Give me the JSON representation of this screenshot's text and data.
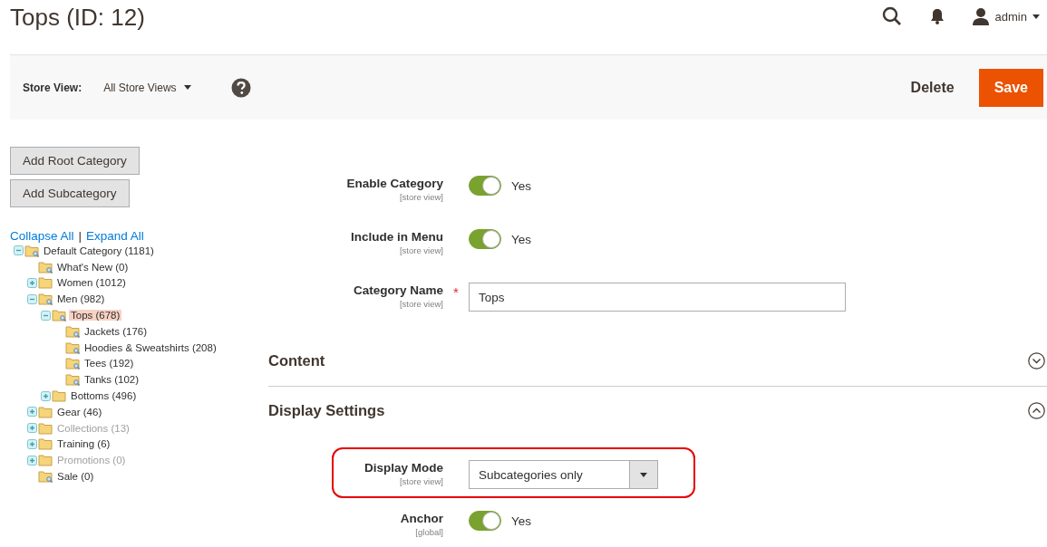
{
  "page_title": "Tops (ID: 12)",
  "header": {
    "user": "admin"
  },
  "toolbar": {
    "store_view_label": "Store View:",
    "store_view_value": "All Store Views",
    "actions": [
      {
        "label": "Delete",
        "kind": "secondary"
      },
      {
        "label": "Save",
        "kind": "primary"
      }
    ]
  },
  "sidebar": {
    "buttons": [
      "Add Root Category",
      "Add Subcategory"
    ],
    "collapse_all": "Collapse All",
    "separator": "|",
    "expand_all": "Expand All",
    "tree": [
      {
        "label": "Default Category (1181)",
        "kind": "branch",
        "expanded": true,
        "selected": false,
        "disabled": false,
        "children": [
          {
            "label": "What's New (0)",
            "kind": "leaf",
            "selected": false,
            "disabled": false
          },
          {
            "label": "Women (1012)",
            "kind": "branch",
            "expanded": false,
            "selected": false,
            "disabled": false
          },
          {
            "label": "Men (982)",
            "kind": "branch",
            "expanded": true,
            "selected": false,
            "disabled": false,
            "children": [
              {
                "label": "Tops (678)",
                "kind": "branch",
                "expanded": true,
                "selected": true,
                "disabled": false,
                "children": [
                  {
                    "label": "Jackets (176)",
                    "kind": "leaf",
                    "selected": false,
                    "disabled": false
                  },
                  {
                    "label": "Hoodies & Sweatshirts (208)",
                    "kind": "leaf",
                    "selected": false,
                    "disabled": false
                  },
                  {
                    "label": "Tees (192)",
                    "kind": "leaf",
                    "selected": false,
                    "disabled": false
                  },
                  {
                    "label": "Tanks (102)",
                    "kind": "leaf",
                    "selected": false,
                    "disabled": false
                  }
                ]
              },
              {
                "label": "Bottoms (496)",
                "kind": "branch",
                "expanded": false,
                "selected": false,
                "disabled": false
              }
            ]
          },
          {
            "label": "Gear (46)",
            "kind": "branch",
            "expanded": false,
            "selected": false,
            "disabled": false
          },
          {
            "label": "Collections (13)",
            "kind": "branch",
            "expanded": false,
            "selected": false,
            "disabled": true
          },
          {
            "label": "Training (6)",
            "kind": "branch",
            "expanded": false,
            "selected": false,
            "disabled": false
          },
          {
            "label": "Promotions (0)",
            "kind": "branch",
            "expanded": false,
            "selected": false,
            "disabled": true
          },
          {
            "label": "Sale (0)",
            "kind": "leaf",
            "selected": false,
            "disabled": false
          }
        ]
      }
    ]
  },
  "fields": [
    {
      "kind": "toggle",
      "label": "Enable Category",
      "scope": "[store view]",
      "on": true,
      "value": "Yes"
    },
    {
      "kind": "toggle",
      "label": "Include in Menu",
      "scope": "[store view]",
      "on": true,
      "value": "Yes"
    },
    {
      "kind": "text",
      "label": "Category Name",
      "scope": "[store view]",
      "required_mark": "*",
      "value": "Tops"
    }
  ],
  "sections": [
    {
      "title": "Content",
      "expanded": false
    },
    {
      "title": "Display Settings",
      "expanded": true,
      "fields": [
        {
          "kind": "select",
          "label": "Display Mode",
          "scope": "[store view]",
          "value": "Subcategories only",
          "highlighted": true
        },
        {
          "kind": "toggle",
          "label": "Anchor",
          "scope": "[global]",
          "on": true,
          "value": "Yes",
          "highlighted": false
        }
      ]
    }
  ]
}
